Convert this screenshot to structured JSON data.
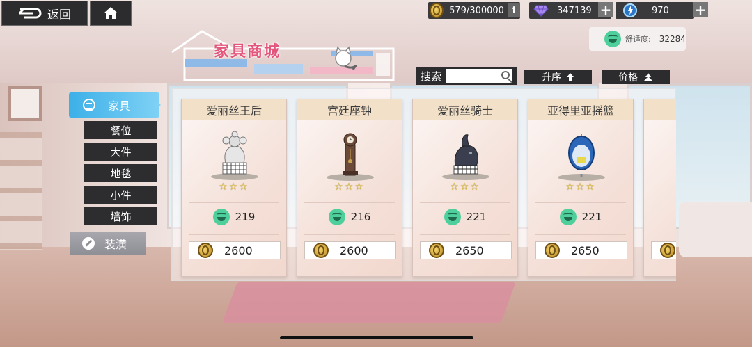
{
  "nav": {
    "back_label": "返回",
    "back_icon": "back-arrow-icon",
    "home_icon": "home-icon"
  },
  "resources": {
    "coins": "579/300000",
    "coins_info": "i",
    "crystals": "347139",
    "stamina": "970"
  },
  "comfort": {
    "label": "舒适度:",
    "value": "32284"
  },
  "title": "家具商城",
  "search": {
    "label": "搜索",
    "value": ""
  },
  "sort": {
    "order_label": "升序",
    "price_label": "价格"
  },
  "sidebar": {
    "main_category": "家具",
    "subcategories": [
      "餐位",
      "大件",
      "地毯",
      "小件",
      "墙饰"
    ],
    "decor_category": "装潢"
  },
  "products": [
    {
      "name": "爱丽丝王后",
      "stars": "☆☆☆",
      "comfort": "219",
      "price": "2600",
      "icon": "chess-queen-icon"
    },
    {
      "name": "宫廷座钟",
      "stars": "☆☆☆",
      "comfort": "216",
      "price": "2600",
      "icon": "grandfather-clock-icon"
    },
    {
      "name": "爱丽丝骑士",
      "stars": "☆☆☆",
      "comfort": "221",
      "price": "2650",
      "icon": "chess-knight-icon"
    },
    {
      "name": "亚得里亚摇篮",
      "stars": "☆☆☆",
      "comfort": "221",
      "price": "2650",
      "icon": "hanging-chair-icon"
    }
  ],
  "colors": {
    "accent_blue": "#3cb0e8",
    "title_pink": "#e4557b",
    "comfort_green": "#4fcf9c",
    "coin_gold": "#d9a63a",
    "dark_button": "#2c2c2e"
  }
}
